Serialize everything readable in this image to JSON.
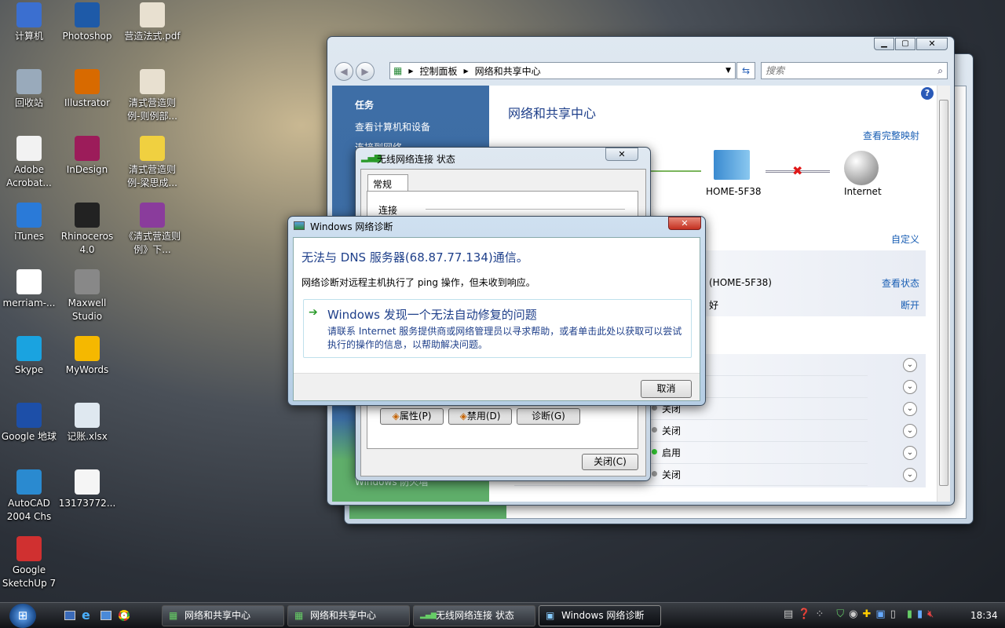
{
  "desktop_icons": [
    {
      "label": "计算机",
      "icon": "computer-icon",
      "color": "#3b6fd0"
    },
    {
      "label": "Photoshop",
      "icon": "photoshop-icon",
      "color": "#1e5aa8"
    },
    {
      "label": "营造法式.pdf",
      "icon": "pdf-document-icon",
      "color": "#e8e0d0"
    },
    {
      "label": "回收站",
      "icon": "recycle-bin-icon",
      "color": "#9ab"
    },
    {
      "label": "Illustrator",
      "icon": "illustrator-icon",
      "color": "#d86a00"
    },
    {
      "label": "清式营造则例-则例部...",
      "icon": "document-icon",
      "color": "#e8e0d0"
    },
    {
      "label": "Adobe Acrobat...",
      "icon": "acrobat-icon",
      "color": "#f2f2f2"
    },
    {
      "label": "InDesign",
      "icon": "indesign-icon",
      "color": "#9c1c5a"
    },
    {
      "label": "清式营造则例-梁思成...",
      "icon": "document-icon",
      "color": "#f0d040"
    },
    {
      "label": "iTunes",
      "icon": "itunes-icon",
      "color": "#2a7ad8"
    },
    {
      "label": "Rhinoceros 4.0",
      "icon": "rhinoceros-icon",
      "color": "#222"
    },
    {
      "label": "《清式营造则例》下...",
      "icon": "winrar-archive-icon",
      "color": "#8a3c9c"
    },
    {
      "label": "merriam-...",
      "icon": "merriam-webster-icon",
      "color": "#fff"
    },
    {
      "label": "Maxwell Studio",
      "icon": "maxwell-icon",
      "color": "#888"
    },
    {
      "label": "Skype",
      "icon": "skype-icon",
      "color": "#1aa3e0"
    },
    {
      "label": "MyWords",
      "icon": "star-icon",
      "color": "#f5b800"
    },
    {
      "label": "Google 地球",
      "icon": "google-earth-icon",
      "color": "#1d4fa8"
    },
    {
      "label": "记账.xlsx",
      "icon": "excel-icon",
      "color": "#dfe8f0"
    },
    {
      "label": "AutoCAD 2004 Chs",
      "icon": "autocad-icon",
      "color": "#2a8ad0"
    },
    {
      "label": "13173772...",
      "icon": "document-icon",
      "color": "#f5f5f5"
    },
    {
      "label": "Google SketchUp 7",
      "icon": "sketchup-icon",
      "color": "#d03030"
    }
  ],
  "network_center": {
    "breadcrumb": [
      "控制面板",
      "网络和共享中心"
    ],
    "search_placeholder": "搜索",
    "tasks_heading": "任务",
    "tasks": [
      "查看计算机和设备",
      "连接到网络"
    ],
    "sidebar_footer": "Windows 防火墙",
    "title": "网络和共享中心",
    "view_full_map": "查看完整映射",
    "map_nodes": [
      "HOME-5F38",
      "Internet"
    ],
    "customize": "自定义",
    "network_name": "(HOME-5F38)",
    "view_status": "查看状态",
    "signal_text": "好",
    "disconnect": "断开",
    "sharing_rows": [
      {
        "status": "",
        "on": false
      },
      {
        "status": "",
        "on": false
      },
      {
        "status": "关闭",
        "on": false
      },
      {
        "status": "关闭",
        "on": false
      },
      {
        "status": "启用",
        "on": true
      },
      {
        "status": "关闭",
        "on": false
      }
    ]
  },
  "wireless_status": {
    "title": "无线网络连接 状态",
    "tab": "常规",
    "section": "连接",
    "buttons": [
      "属性(P)",
      "禁用(D)",
      "诊断(G)"
    ],
    "close": "关闭(C)"
  },
  "diagnostic": {
    "title": "Windows 网络诊断",
    "headline": "无法与 DNS 服务器(68.87.77.134)通信。",
    "detail": "网络诊断对远程主机执行了 ping 操作，但未收到响应。",
    "option_title": "Windows 发现一个无法自动修复的问题",
    "option_desc": "请联系 Internet 服务提供商或网络管理员以寻求帮助，或者单击此处以获取可以尝试执行的操作的信息，以帮助解决问题。",
    "cancel": "取消"
  },
  "taskbar": {
    "tasks": [
      "网络和共享中心",
      "网络和共享中心",
      "无线网络连接 状态",
      "Windows 网络诊断"
    ],
    "clock": "18:34"
  }
}
